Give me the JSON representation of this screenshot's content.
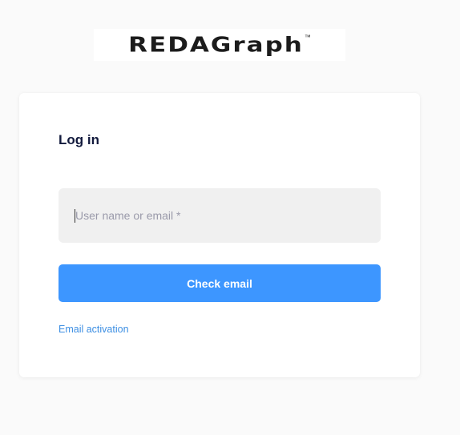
{
  "logo": {
    "name": "REDAGraph",
    "trademark": "™"
  },
  "login": {
    "title": "Log in",
    "username_placeholder": "User name or email *",
    "username_value": "",
    "submit_label": "Check email",
    "activation_link": "Email activation"
  },
  "colors": {
    "accent": "#3d96ff",
    "link": "#3d8fe3",
    "title": "#121a3d",
    "input_bg": "#f0f0f0"
  }
}
